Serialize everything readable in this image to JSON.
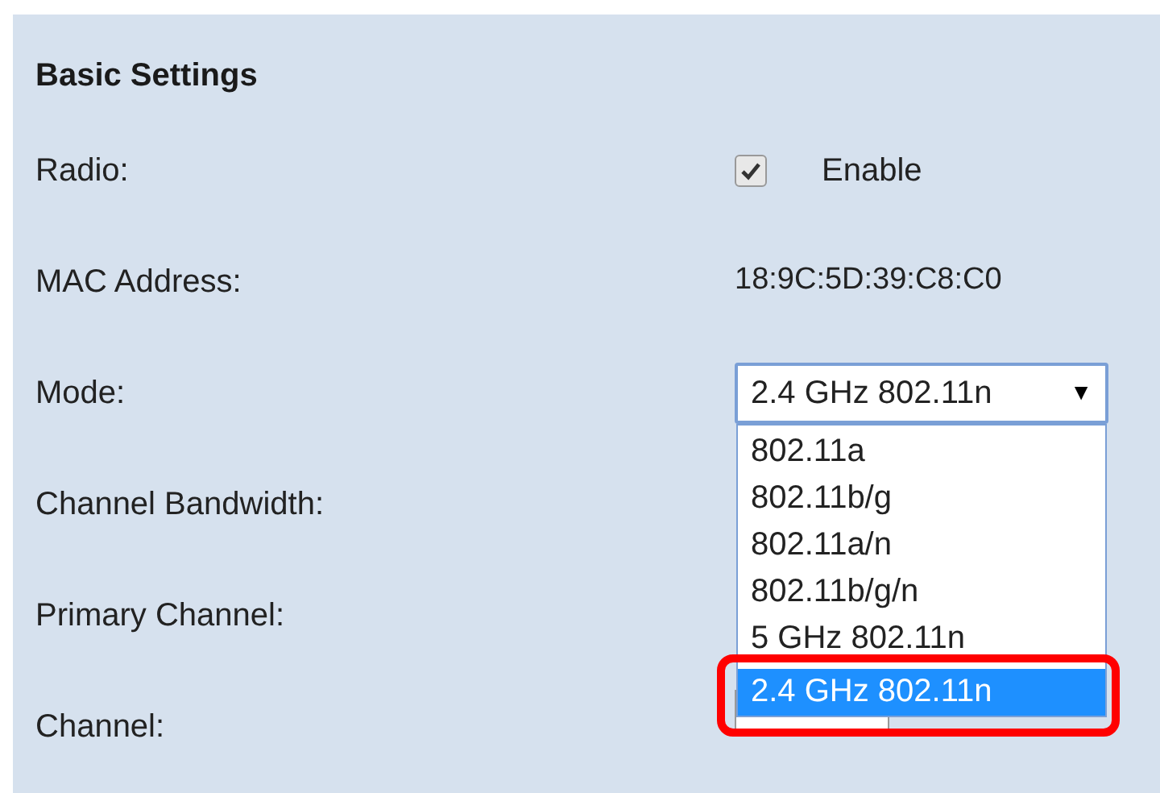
{
  "section": {
    "title": "Basic Settings"
  },
  "rows": [
    {
      "kind": "checkbox",
      "label": "Radio:",
      "checked": true,
      "text": "Enable"
    },
    {
      "kind": "text",
      "label": "MAC Address:",
      "value": "18:9C:5D:39:C8:C0"
    },
    {
      "kind": "select",
      "label": "Mode:",
      "value": "2.4 GHz 802.11n",
      "arrow": "▼",
      "expanded": true,
      "options": [
        {
          "label": "802.11a",
          "selected": false
        },
        {
          "label": "802.11b/g",
          "selected": false
        },
        {
          "label": "802.11a/n",
          "selected": false
        },
        {
          "label": "802.11b/g/n",
          "selected": false
        },
        {
          "label": "5 GHz 802.11n",
          "selected": false
        },
        {
          "label": "2.4 GHz 802.11n",
          "selected": true,
          "highlighted": true
        }
      ]
    },
    {
      "kind": "label",
      "label": "Channel Bandwidth:"
    },
    {
      "kind": "label",
      "label": "Primary Channel:"
    },
    {
      "kind": "field",
      "label": "Channel:"
    }
  ]
}
